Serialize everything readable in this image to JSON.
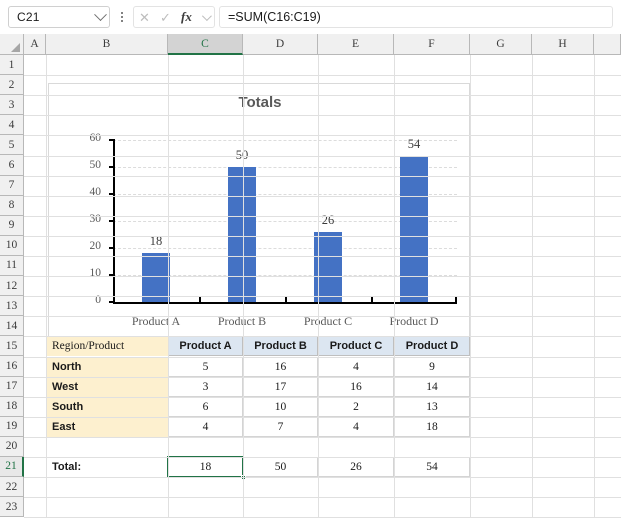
{
  "formula_bar": {
    "name_box_value": "C21",
    "formula_value": "=SUM(C16:C19)",
    "cancel_icon": "close-icon",
    "enter_icon": "check-icon",
    "fx_label": "fx"
  },
  "grid": {
    "column_headers": [
      "A",
      "B",
      "C",
      "D",
      "E",
      "F",
      "G",
      "H"
    ],
    "selected_column": "C",
    "row_headers": [
      "1",
      "2",
      "3",
      "4",
      "5",
      "6",
      "7",
      "8",
      "9",
      "10",
      "11",
      "12",
      "13",
      "14",
      "15",
      "16",
      "17",
      "18",
      "19",
      "20",
      "21",
      "22",
      "23"
    ],
    "selected_row": "21",
    "selected_cell": "C21",
    "selected_cell_value": "18"
  },
  "chart_data": {
    "type": "bar",
    "title": "Totals",
    "categories": [
      "Product A",
      "Product B",
      "Product C",
      "Product D"
    ],
    "values": [
      18,
      50,
      26,
      54
    ],
    "data_labels": [
      "18",
      "50",
      "26",
      "54"
    ],
    "ytick_labels": [
      "60",
      "50",
      "40",
      "30",
      "20",
      "10",
      "0"
    ],
    "yticks": [
      60,
      50,
      40,
      30,
      20,
      10,
      0
    ],
    "ylim": [
      0,
      60
    ],
    "xlabel": "",
    "ylabel": "",
    "grid": true,
    "legend": "none",
    "series_color": "#4472c4"
  },
  "table": {
    "corner_label": "Region/Product",
    "column_headers": [
      "Product A",
      "Product B",
      "Product C",
      "Product D"
    ],
    "rows": [
      {
        "region": "North",
        "values": [
          "5",
          "16",
          "4",
          "9"
        ]
      },
      {
        "region": "West",
        "values": [
          "3",
          "17",
          "16",
          "14"
        ]
      },
      {
        "region": "South",
        "values": [
          "6",
          "10",
          "2",
          "13"
        ]
      },
      {
        "region": "East",
        "values": [
          "4",
          "7",
          "4",
          "18"
        ]
      }
    ],
    "total_label": "Total:",
    "totals": [
      "18",
      "50",
      "26",
      "54"
    ]
  },
  "colors": {
    "excel_green": "#217346",
    "bar_blue": "#4472c4",
    "header_fill": "#dce6f1",
    "region_fill": "#fdf0cf"
  }
}
